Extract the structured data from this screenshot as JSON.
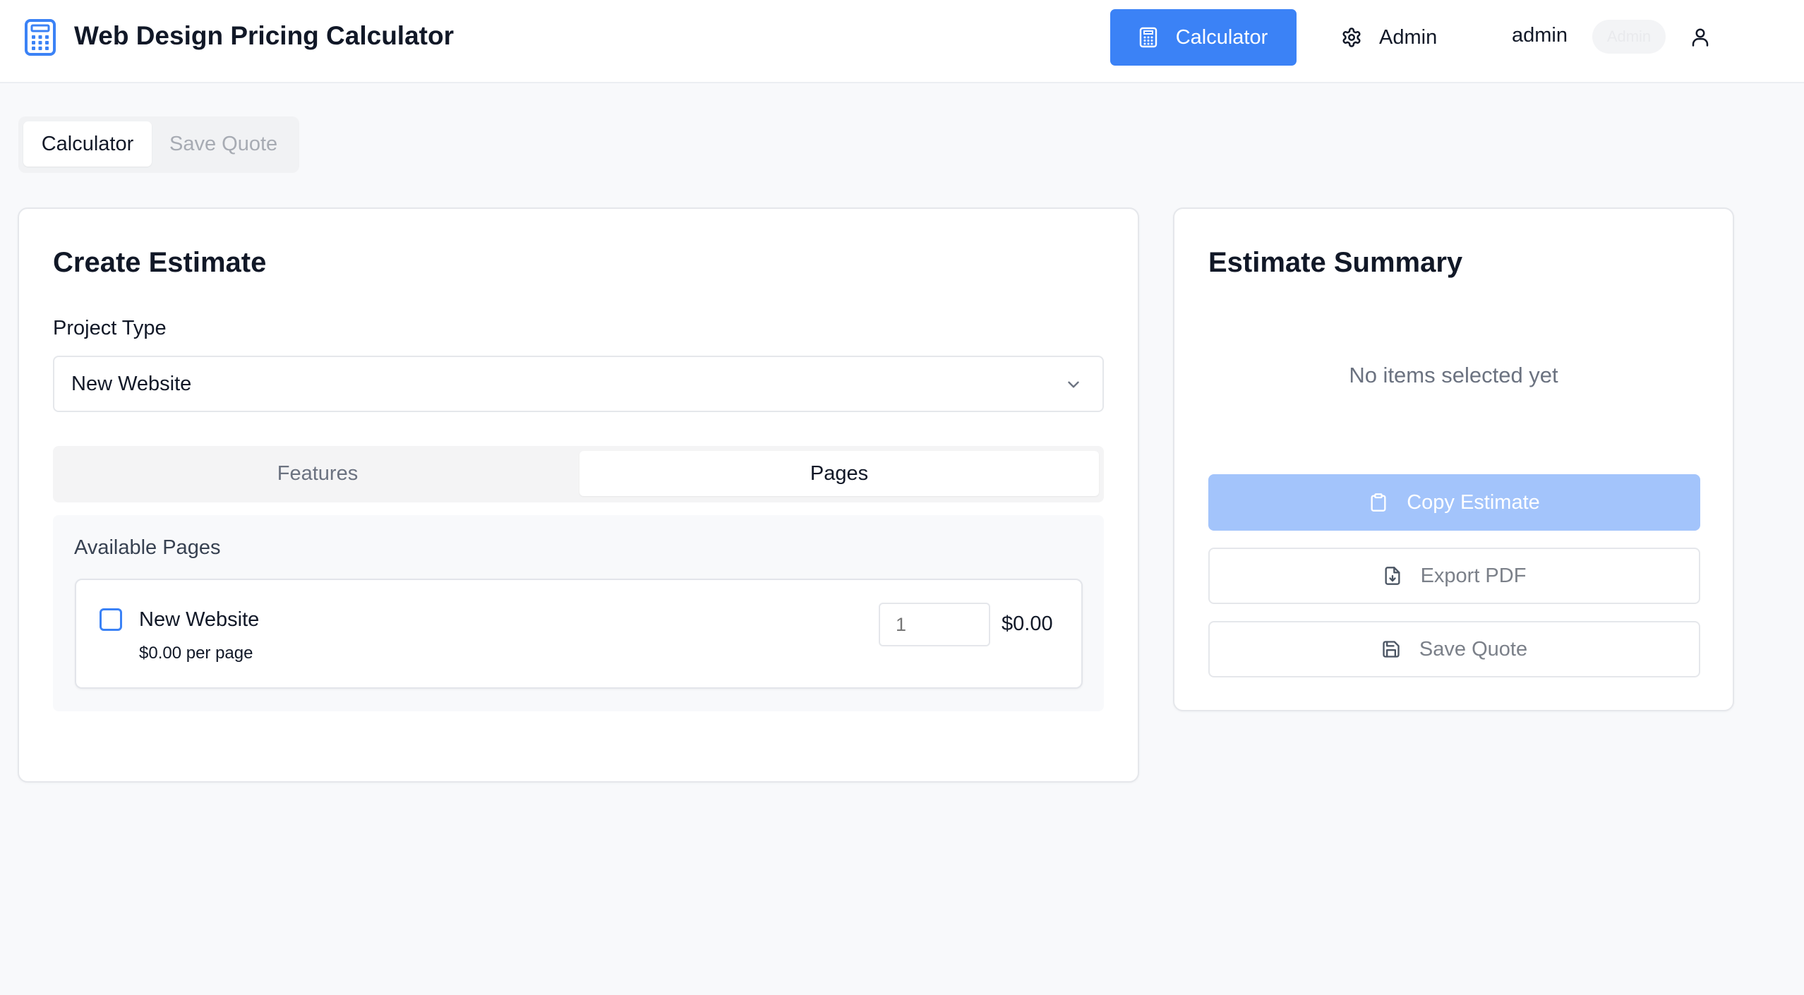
{
  "header": {
    "app_title": "Web Design Pricing Calculator",
    "nav": {
      "calculator_label": "Calculator",
      "admin_label": "Admin"
    },
    "user": {
      "name": "admin",
      "role_badge": "Admin"
    }
  },
  "top_tabs": {
    "items": [
      {
        "label": "Calculator",
        "active": true
      },
      {
        "label": "Save Quote",
        "active": false
      }
    ]
  },
  "estimate": {
    "title": "Create Estimate",
    "project_type_label": "Project Type",
    "project_type_value": "New Website",
    "sub_tabs": [
      {
        "label": "Features",
        "active": false
      },
      {
        "label": "Pages",
        "active": true
      }
    ],
    "pages_panel": {
      "label": "Available Pages",
      "items": [
        {
          "name": "New Website",
          "price_text": "$0.00 per page",
          "quantity_placeholder": "1",
          "checked": false,
          "total": "$0.00"
        }
      ]
    }
  },
  "summary": {
    "title": "Estimate Summary",
    "empty_text": "No items selected yet",
    "buttons": {
      "copy": "Copy Estimate",
      "export": "Export PDF",
      "save": "Save Quote"
    }
  },
  "colors": {
    "primary": "#3b82f6",
    "primary_disabled": "#a3c4fb",
    "background": "#f8f9fb",
    "text": "#111827",
    "muted": "#6b7280"
  },
  "icons": {
    "logo": "calculator-icon",
    "nav_calculator": "calculator-icon",
    "nav_admin": "gear-icon",
    "user": "user-icon",
    "select": "chevron-down-icon",
    "copy": "clipboard-icon",
    "export": "file-download-icon",
    "save": "floppy-disk-icon"
  }
}
